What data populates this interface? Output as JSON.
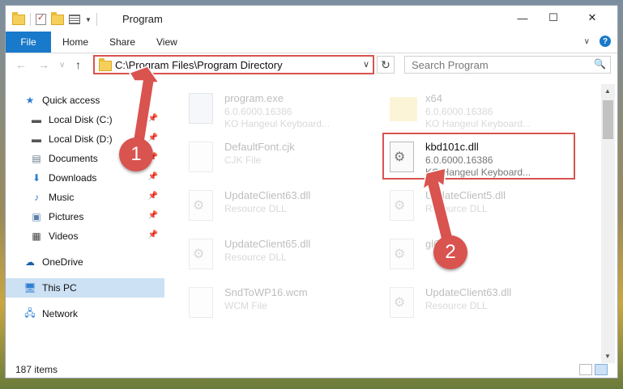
{
  "window": {
    "title": "Program",
    "controls": {
      "minimize": "—",
      "maximize": "☐",
      "close": "✕"
    }
  },
  "ribbon": {
    "tabs": [
      "File",
      "Home",
      "Share",
      "View"
    ],
    "help": "?"
  },
  "navbar": {
    "back": "←",
    "forward": "→",
    "recent": "∨",
    "up": "↑",
    "address": "C:\\Program Files\\Program Directory",
    "refresh": "↻",
    "search_placeholder": "Search Program"
  },
  "sidebar": {
    "items": [
      {
        "label": "Quick access",
        "icon": "star-icon"
      },
      {
        "label": "Local Disk (C:)",
        "icon": "drive-icon"
      },
      {
        "label": "Local Disk (D:)",
        "icon": "drive-icon"
      },
      {
        "label": "Documents",
        "icon": "documents-icon"
      },
      {
        "label": "Downloads",
        "icon": "downloads-icon"
      },
      {
        "label": "Music",
        "icon": "music-icon"
      },
      {
        "label": "Pictures",
        "icon": "pictures-icon"
      },
      {
        "label": "Videos",
        "icon": "videos-icon"
      },
      {
        "label": "OneDrive",
        "icon": "cloud-icon"
      },
      {
        "label": "This PC",
        "icon": "computer-icon"
      },
      {
        "label": "Network",
        "icon": "network-icon"
      }
    ]
  },
  "files": [
    {
      "name": "program.exe",
      "line1": "6.0.6000.16386",
      "line2": "KO Hangeul Keyboard...",
      "icon": "exe"
    },
    {
      "name": "x64",
      "line1": "6.0.6000.16386",
      "line2": "KO Hangeul Keyboard...",
      "icon": "folder"
    },
    {
      "name": "DefaultFont.cjk",
      "line1": "CJK File",
      "line2": "",
      "icon": "file"
    },
    {
      "name": "kbd101c.dll",
      "line1": "6.0.6000.16386",
      "line2": "KO Hangeul Keyboard...",
      "icon": "gear"
    },
    {
      "name": "UpdateClient63.dll",
      "line1": "Resource DLL",
      "line2": "",
      "icon": "gear"
    },
    {
      "name": "UpdateClient5.dll",
      "line1": "Resource DLL",
      "line2": "",
      "icon": "gear"
    },
    {
      "name": "UpdateClient65.dll",
      "line1": "Resource DLL",
      "line2": "",
      "icon": "gear"
    },
    {
      "name": "gl64",
      "line1": "",
      "line2": "",
      "icon": "gear"
    },
    {
      "name": "SndToWP16.wcm",
      "line1": "WCM File",
      "line2": "",
      "icon": "file"
    },
    {
      "name": "UpdateClient63.dll",
      "line1": "Resource DLL",
      "line2": "",
      "icon": "gear"
    }
  ],
  "status": {
    "count": "187 items"
  },
  "callouts": {
    "one": "1",
    "two": "2"
  },
  "colors": {
    "accent": "#1979ca",
    "highlight": "#d9534f",
    "selected": "#cde1f4"
  }
}
